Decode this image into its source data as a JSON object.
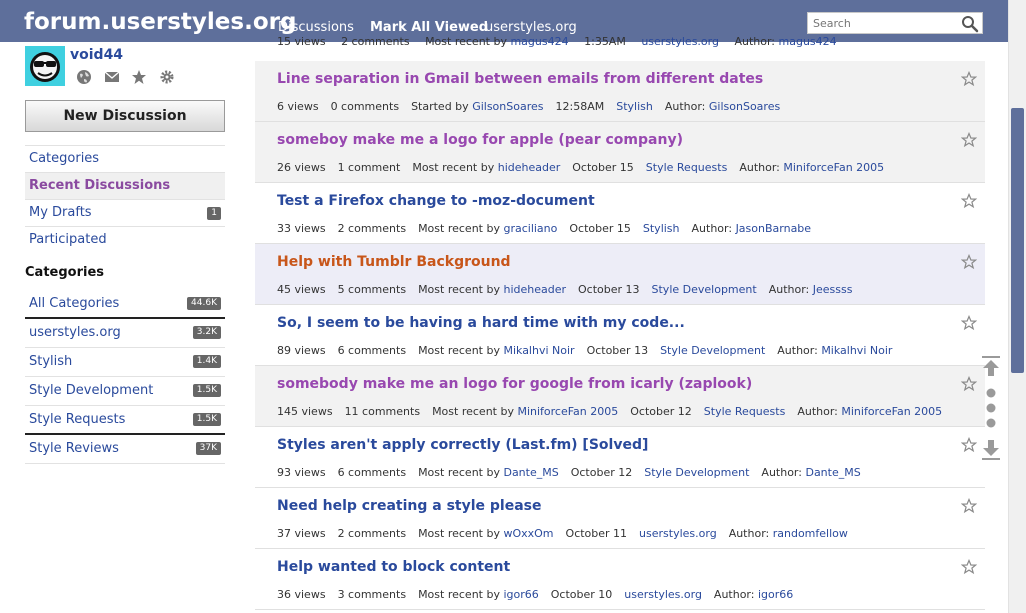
{
  "header": {
    "site_title": "forum.userstyles.org",
    "nav": [
      "Discussions",
      "Mark All Viewed",
      "userstyles.org"
    ],
    "search_placeholder": "Search"
  },
  "user": {
    "name": "void44"
  },
  "sidebar": {
    "new_discussion": "New Discussion",
    "nav": [
      {
        "label": "Categories",
        "count": null
      },
      {
        "label": "Recent Discussions",
        "count": null
      },
      {
        "label": "My Drafts",
        "count": "1"
      },
      {
        "label": "Participated",
        "count": null
      }
    ],
    "categories_heading": "Categories",
    "categories": [
      {
        "label": "All Categories",
        "count": "44.6K"
      },
      {
        "label": "userstyles.org",
        "count": "3.2K"
      },
      {
        "label": "Stylish",
        "count": "1.4K"
      },
      {
        "label": "Style Development",
        "count": "1.5K"
      },
      {
        "label": "Style Requests",
        "count": "1.5K"
      },
      {
        "label": "Style Reviews",
        "count": "37K"
      }
    ]
  },
  "partial_row": {
    "views": "15 views",
    "comments": "2 comments",
    "by_label": "Most recent by",
    "by": "magus424",
    "time": "1:35AM",
    "category": "userstyles.org",
    "author_label": "Author:",
    "author": "magus424"
  },
  "discussions": [
    {
      "title": "Line separation in Gmail between emails from different dates",
      "views": "6 views",
      "comments": "0 comments",
      "by_label": "Started by",
      "by": "GilsonSoares",
      "time": "12:58AM",
      "category": "Stylish",
      "author_label": "Author:",
      "author": "GilsonSoares",
      "state": "read"
    },
    {
      "title": "someboy make me a logo for apple  (pear company)",
      "views": "26 views",
      "comments": "1 comment",
      "by_label": "Most recent by",
      "by": "hideheader",
      "time": "October 15",
      "category": "Style Requests",
      "author_label": "Author:",
      "author": "MiniforceFan 2005",
      "state": "read"
    },
    {
      "title": "Test a Firefox change to -moz-document",
      "views": "33 views",
      "comments": "2 comments",
      "by_label": "Most recent by",
      "by": "graciliano",
      "time": "October 15",
      "category": "Stylish",
      "author_label": "Author:",
      "author": "JasonBarnabe",
      "state": "new"
    },
    {
      "title": "Help with Tumblr Background",
      "views": "45 views",
      "comments": "5 comments",
      "by_label": "Most recent by",
      "by": "hideheader",
      "time": "October 13",
      "category": "Style Development",
      "author_label": "Author:",
      "author": "Jeessss",
      "state": "hover"
    },
    {
      "title": "So, I seem to be having a hard time with my code...",
      "views": "89 views",
      "comments": "6 comments",
      "by_label": "Most recent by",
      "by": "Mikalhvi Noir",
      "time": "October 13",
      "category": "Style Development",
      "author_label": "Author:",
      "author": "Mikalhvi Noir",
      "state": "new"
    },
    {
      "title": "somebody make me an logo for google from icarly (zaplook)",
      "views": "145 views",
      "comments": "11 comments",
      "by_label": "Most recent by",
      "by": "MiniforceFan 2005",
      "time": "October 12",
      "category": "Style Requests",
      "author_label": "Author:",
      "author": "MiniforceFan 2005",
      "state": "read"
    },
    {
      "title": "Styles aren't apply correctly (Last.fm) [Solved]",
      "views": "93 views",
      "comments": "6 comments",
      "by_label": "Most recent by",
      "by": "Dante_MS",
      "time": "October 12",
      "category": "Style Development",
      "author_label": "Author:",
      "author": "Dante_MS",
      "state": "new"
    },
    {
      "title": "Need help creating a style please",
      "views": "37 views",
      "comments": "2 comments",
      "by_label": "Most recent by",
      "by": "wOxxOm",
      "time": "October 11",
      "category": "userstyles.org",
      "author_label": "Author:",
      "author": "randomfellow",
      "state": "new"
    },
    {
      "title": "Help wanted to block content",
      "views": "36 views",
      "comments": "3 comments",
      "by_label": "Most recent by",
      "by": "igor66",
      "time": "October 10",
      "category": "userstyles.org",
      "author_label": "Author:",
      "author": "igor66",
      "state": "new"
    }
  ],
  "colors": {
    "header_bg": "#5e6f9b",
    "link": "#2a4a9c",
    "read_title": "#9848b0",
    "hover_title": "#c8561a"
  }
}
